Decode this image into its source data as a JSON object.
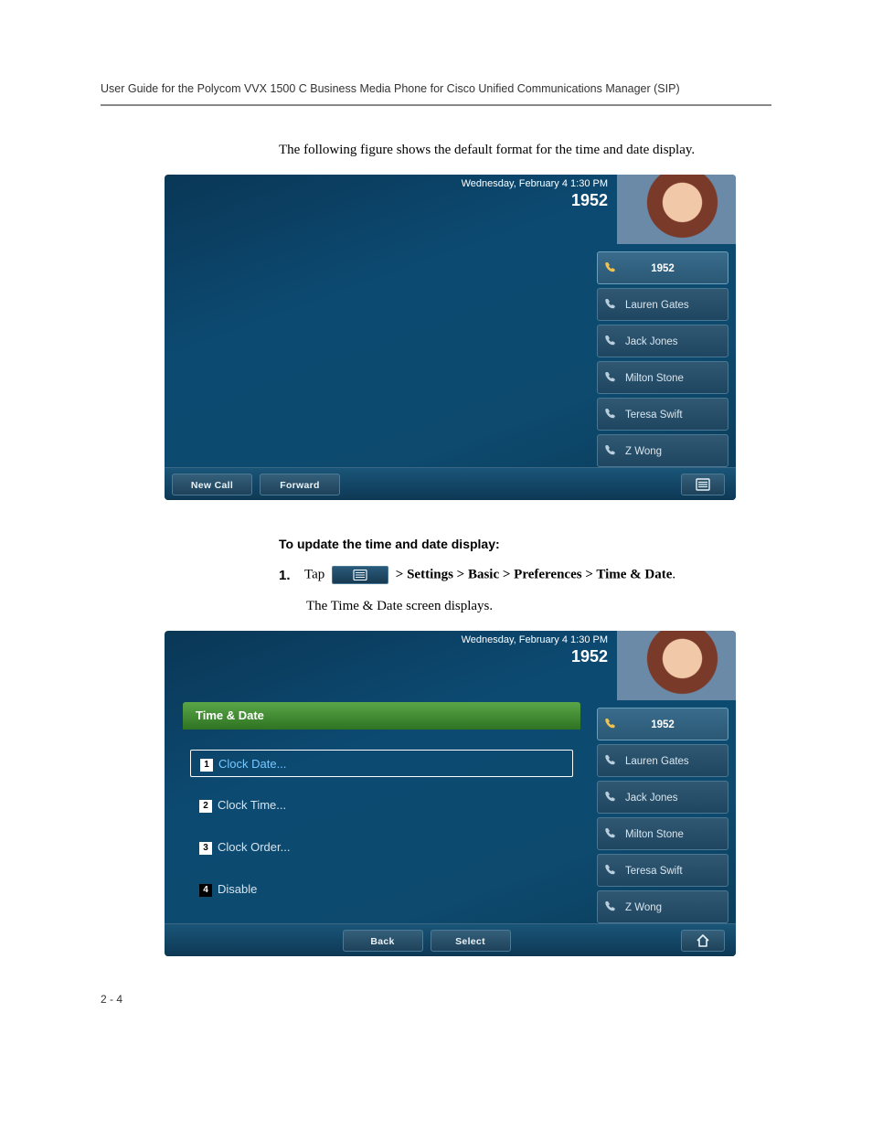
{
  "header": {
    "title": "User Guide for the Polycom VVX 1500 C Business Media Phone for Cisco Unified Communications Manager (SIP)"
  },
  "intro_text": "The following figure shows the default format for the time and date display.",
  "phone_common": {
    "datetime": "Wednesday, February 4  1:30 PM",
    "extension": "1952",
    "contacts": [
      {
        "label": "1952",
        "active": true
      },
      {
        "label": "Lauren Gates",
        "active": false
      },
      {
        "label": "Jack Jones",
        "active": false
      },
      {
        "label": "Milton Stone",
        "active": false
      },
      {
        "label": "Teresa Swift",
        "active": false
      },
      {
        "label": "Z Wong",
        "active": false
      }
    ]
  },
  "figure1": {
    "softkeys": {
      "left1": "New Call",
      "left2": "Forward"
    }
  },
  "section_head": "To update the time and date display:",
  "step1": {
    "num": "1.",
    "tap": "Tap",
    "path": " > Settings > Basic > Preferences > Time & Date",
    "trail": "."
  },
  "step1_result": "The Time & Date screen displays.",
  "figure2": {
    "menu_title": "Time & Date",
    "items": [
      {
        "num": "1",
        "label": "Clock Date...",
        "selected": true
      },
      {
        "num": "2",
        "label": "Clock Time...",
        "selected": false
      },
      {
        "num": "3",
        "label": "Clock Order...",
        "selected": false
      },
      {
        "num": "4",
        "label": "Disable",
        "selected": false,
        "dark": true
      }
    ],
    "softkeys": {
      "left": "Back",
      "right": "Select"
    }
  },
  "footer": {
    "page": "2 - 4"
  }
}
